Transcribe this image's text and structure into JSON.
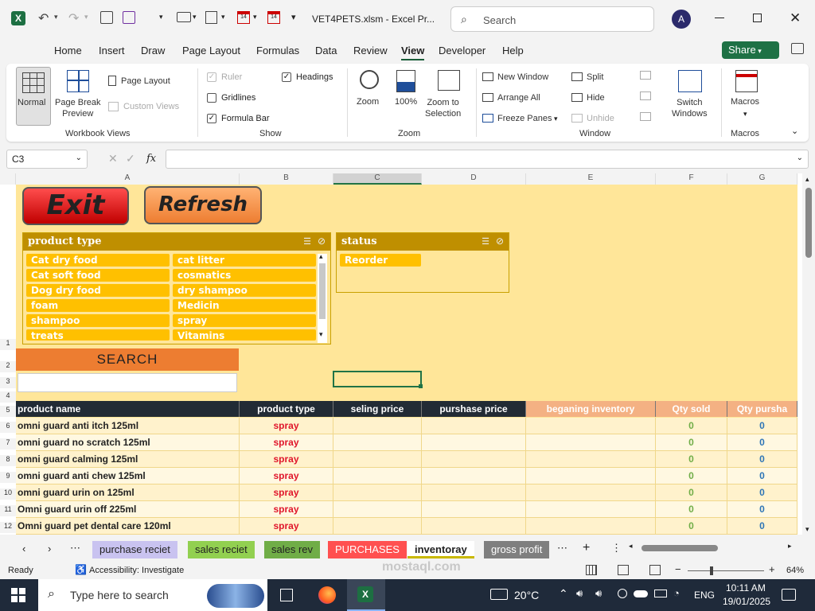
{
  "titlebar": {
    "filename": "VET4PETS.xlsm  -  Excel Pr...",
    "search_placeholder": "Search",
    "avatar_letter": "A"
  },
  "tabs": [
    "Home",
    "Insert",
    "Draw",
    "Page Layout",
    "Formulas",
    "Data",
    "Review",
    "View",
    "Developer",
    "Help"
  ],
  "share_label": "Share",
  "ribbon": {
    "normal": "Normal",
    "page_break": "Page Break\nPreview",
    "page_layout": "Page Layout",
    "custom_views": "Custom Views",
    "workbook_views": "Workbook Views",
    "ruler": "Ruler",
    "gridlines": "Gridlines",
    "formula_bar": "Formula Bar",
    "headings": "Headings",
    "show": "Show",
    "zoom": "Zoom",
    "zoom_100": "100%",
    "zoom_selection": "Zoom to\nSelection",
    "zoom_group": "Zoom",
    "new_window": "New Window",
    "arrange_all": "Arrange All",
    "freeze_panes": "Freeze Panes",
    "split": "Split",
    "hide": "Hide",
    "unhide": "Unhide",
    "switch_windows": "Switch\nWindows",
    "window_group": "Window",
    "macros": "Macros",
    "macros_group": "Macros"
  },
  "formula": {
    "name_box": "C3",
    "fx": "fx",
    "content": ""
  },
  "columns": [
    "A",
    "B",
    "C",
    "D",
    "E",
    "F",
    "G"
  ],
  "buttons": {
    "exit": "Exit",
    "refresh": "Refresh"
  },
  "slicer_product": {
    "title": "product type",
    "items_left": [
      "Cat dry food",
      "Cat soft food",
      "Dog dry food",
      "foam",
      "shampoo",
      "treats"
    ],
    "items_right": [
      "cat litter",
      "cosmatics",
      "dry shampoo",
      "Medicin",
      "spray",
      "Vitamins"
    ]
  },
  "slicer_status": {
    "title": "status",
    "items": [
      "Reorder"
    ]
  },
  "search_label": "SEARCH",
  "table": {
    "headers": [
      "product name",
      "product type",
      "seling price",
      "purshase price",
      "beganing inventory",
      "Qty sold",
      "Qty pursha"
    ],
    "rows": [
      {
        "name": "omni guard anti itch 125ml",
        "type": "spray",
        "sold": "0",
        "pur": "0"
      },
      {
        "name": "omni guard no scratch 125ml",
        "type": "spray",
        "sold": "0",
        "pur": "0"
      },
      {
        "name": "omni guard calming  125ml",
        "type": "spray",
        "sold": "0",
        "pur": "0"
      },
      {
        "name": "omni guard anti chew 125ml",
        "type": "spray",
        "sold": "0",
        "pur": "0"
      },
      {
        "name": "omni guard urin on 125ml",
        "type": "spray",
        "sold": "0",
        "pur": "0"
      },
      {
        "name": "Omni guard urin off 225ml",
        "type": "spray",
        "sold": "0",
        "pur": "0"
      },
      {
        "name": "Omni guard pet dental care 120ml",
        "type": "spray",
        "sold": "0",
        "pur": "0"
      }
    ]
  },
  "row_numbers": [
    "1",
    "2",
    "3",
    "4",
    "5",
    "6",
    "7",
    "8",
    "9",
    "10",
    "11",
    "12"
  ],
  "sheet_tabs": [
    {
      "label": "purchase reciet",
      "bg": "#c9c3f0",
      "fg": "#222"
    },
    {
      "label": "sales reciet",
      "bg": "#92d050",
      "fg": "#222"
    },
    {
      "label": "sales rev",
      "bg": "#70ad47",
      "fg": "#222"
    },
    {
      "label": "PURCHASES",
      "bg": "#ff5050",
      "fg": "#fff"
    },
    {
      "label": "inventoray",
      "bg": "#ffffff",
      "fg": "#222"
    },
    {
      "label": "gross profit",
      "bg": "#7f7f7f",
      "fg": "#fff"
    }
  ],
  "status": {
    "ready": "Ready",
    "accessibility": "Accessibility: Investigate",
    "zoom": "64%"
  },
  "taskbar": {
    "search": "Type here to search",
    "temp": "20°C",
    "lang": "ENG",
    "time": "10:11 AM",
    "date": "19/01/2025"
  },
  "watermark": "mostaql.com"
}
